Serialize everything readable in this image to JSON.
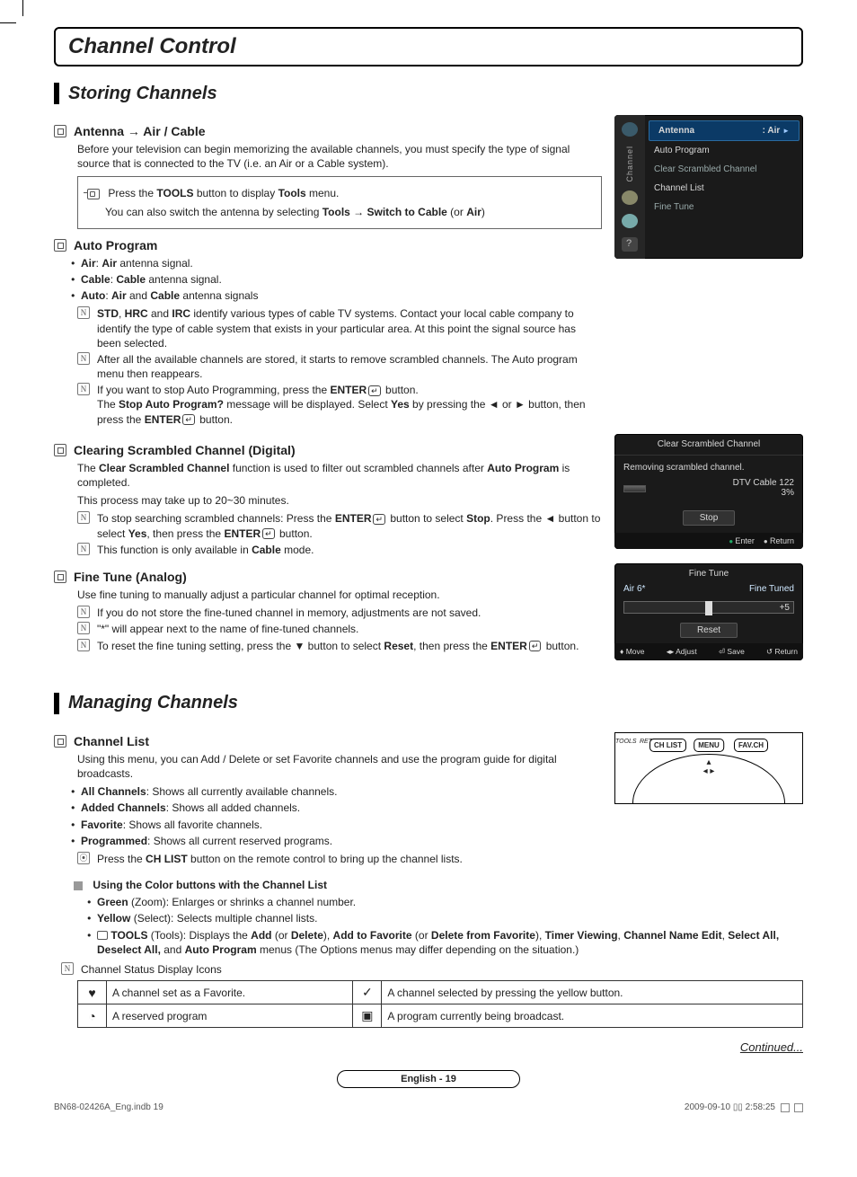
{
  "page": {
    "title": "Channel Control",
    "continued": "Continued...",
    "footer_label": "English - 19",
    "print_left": "BN68-02426A_Eng.indb   19",
    "print_date": "2009-09-10   ▯▯ 2:58:25"
  },
  "storing": {
    "heading": "Storing Channels",
    "antenna": {
      "heading": "Antenna → Air / Cable",
      "p1": "Before your television can begin memorizing the available channels, you must specify the type of signal source that is connected to the TV (i.e. an Air or a Cable system).",
      "tools_l1_a": "Press the ",
      "tools_l1_b": "TOOLS",
      "tools_l1_c": " button to display ",
      "tools_l1_d": "Tools",
      "tools_l1_e": " menu.",
      "tools_l2_a": "You can also switch the antenna by selecting ",
      "tools_l2_b": "Tools → Switch to Cable",
      "tools_l2_c": " (or ",
      "tools_l2_d": "Air",
      "tools_l2_e": ")"
    },
    "auto": {
      "heading": "Auto Program",
      "li1_a": "Air",
      "li1_b": ": ",
      "li1_c": "Air",
      "li1_d": " antenna signal.",
      "li2_a": "Cable",
      "li2_b": ": ",
      "li2_c": "Cable",
      "li2_d": " antenna signal.",
      "li3_a": "Auto",
      "li3_b": ": ",
      "li3_c": "Air",
      "li3_d": " and ",
      "li3_e": "Cable",
      "li3_f": " antenna signals",
      "n1_a": "STD",
      "n1_b": ", ",
      "n1_c": "HRC",
      "n1_d": " and ",
      "n1_e": "IRC",
      "n1_f": " identify various types of cable TV systems. Contact your local cable company to identify the type of cable system that exists in your particular area. At this point the signal source has been selected.",
      "n2": "After all the available channels are stored, it starts to remove scrambled channels. The Auto program menu then reappears.",
      "n3_a": "If you want to stop Auto Programming, press the ",
      "n3_b": "ENTER",
      "n3_c": " button.",
      "n3_d": "The ",
      "n3_e": "Stop Auto Program?",
      "n3_f": " message will be displayed. Select ",
      "n3_g": "Yes",
      "n3_h": " by pressing the ◄ or ► button, then press the ",
      "n3_i": "ENTER",
      "n3_j": " button."
    },
    "clearing": {
      "heading": "Clearing Scrambled Channel (Digital)",
      "p1_a": "The ",
      "p1_b": "Clear Scrambled Channel",
      "p1_c": " function is used to filter out scrambled channels after ",
      "p1_d": "Auto Program",
      "p1_e": " is completed.",
      "p2": "This process may take up to 20~30 minutes.",
      "n1_a": "To stop searching scrambled channels: Press the ",
      "n1_b": "ENTER",
      "n1_c": " button to select ",
      "n1_d": "Stop",
      "n1_e": ". Press the ◄ button to select ",
      "n1_f": "Yes",
      "n1_g": ", then press the ",
      "n1_h": "ENTER",
      "n1_i": " button.",
      "n2_a": "This function is only available in ",
      "n2_b": "Cable",
      "n2_c": " mode."
    },
    "fine": {
      "heading": "Fine Tune (Analog)",
      "p1": "Use fine tuning to manually adjust a particular channel for optimal reception.",
      "n1": "If you do not store the fine-tuned channel in memory, adjustments are not saved.",
      "n2": "\"*\" will appear next to the name of fine-tuned channels.",
      "n3_a": "To reset the fine tuning setting, press the ▼ button to select ",
      "n3_b": "Reset",
      "n3_c": ", then press the ",
      "n3_d": "ENTER",
      "n3_e": " button."
    }
  },
  "osd": {
    "sidebar_label": "Channel",
    "antenna_label": "Antenna",
    "antenna_value": ": Air",
    "items": [
      "Auto Program",
      "Clear Scrambled Channel",
      "Channel List",
      "Fine Tune"
    ],
    "clear": {
      "title": "Clear Scrambled Channel",
      "msg": "Removing scrambled channel.",
      "ch": "DTV Cable 122",
      "pct": "3%",
      "stop": "Stop",
      "enter": "Enter",
      "return": "Return"
    },
    "fine": {
      "title": "Fine Tune",
      "ch": "Air 6*",
      "status": "Fine Tuned",
      "val": "+5",
      "reset": "Reset",
      "move": "Move",
      "adjust": "Adjust",
      "save": "Save",
      "return": "Return"
    }
  },
  "managing": {
    "heading": "Managing Channels",
    "chlist": {
      "heading": "Channel List",
      "p1": "Using this menu, you can Add / Delete or set Favorite channels and use the program guide for digital broadcasts.",
      "li1_a": "All Channels",
      "li1_b": ": Shows all currently available channels.",
      "li2_a": "Added Channels",
      "li2_b": ": Shows all added channels.",
      "li3_a": "Favorite",
      "li3_b": ": Shows all favorite channels.",
      "li4_a": "Programmed",
      "li4_b": ": Shows all current reserved programs.",
      "note_a": "Press the ",
      "note_b": "CH LIST",
      "note_c": " button on the remote control to bring up the channel lists."
    },
    "color": {
      "heading": "Using the Color buttons with the Channel List",
      "li1_a": "Green",
      "li1_b": " (Zoom): Enlarges or shrinks a channel number.",
      "li2_a": "Yellow",
      "li2_b": " (Select): Selects multiple channel lists.",
      "li3_a": "TOOLS",
      "li3_b": " (Tools): Displays the ",
      "li3_c": "Add",
      "li3_d": " (or ",
      "li3_e": "Delete",
      "li3_f": "), ",
      "li3_g": "Add to Favorite",
      "li3_h": " (or ",
      "li3_i": "Delete from Favorite",
      "li3_j": "), ",
      "li3_k": "Timer Viewing",
      "li3_l": ", ",
      "li3_m": "Channel Name Edit",
      "li3_n": ", ",
      "li3_o": "Select All, Deselect All,",
      "li3_p": " and ",
      "li3_q": "Auto Program",
      "li3_r": " menus (The Options menus may differ depending on the situation.)"
    },
    "status": {
      "heading": "Channel Status Display Icons",
      "r1c1": "A channel set as a Favorite.",
      "r1c2": "A channel selected by pressing the yellow button.",
      "r2c1": "A reserved program",
      "r2c2": "A program currently being broadcast."
    },
    "remote": {
      "chlist": "CH LIST",
      "menu": "MENU",
      "favch": "FAV.CH",
      "tools": "TOOLS",
      "return": "RETURN"
    }
  }
}
